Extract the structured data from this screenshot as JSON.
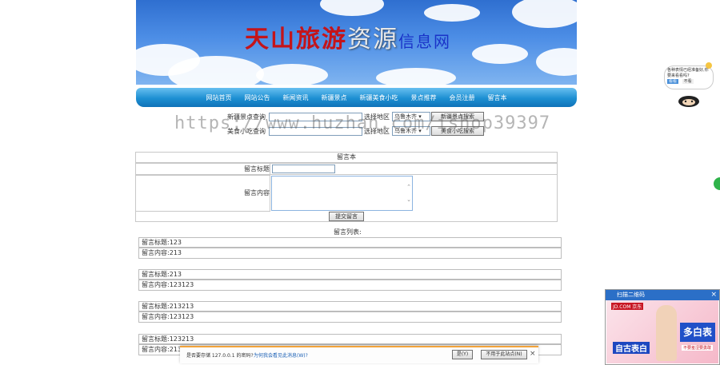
{
  "site_title": {
    "part1": "天山旅游",
    "part2": "资源",
    "part3": "信息网"
  },
  "nav": [
    "网站首页",
    "网站公告",
    "新闻资讯",
    "新疆景点",
    "新疆美食小吃",
    "景点推荐",
    "会员注册",
    "留言本"
  ],
  "search_spots": {
    "label": "新疆景点查询",
    "region_label": "选择地区",
    "region_value": "乌鲁木齐",
    "button": "新疆景点搜索"
  },
  "search_food": {
    "label": "美食小吃查询",
    "region_label": "选择地区",
    "region_value": "乌鲁木齐",
    "button": "美食小吃搜索"
  },
  "watermark": "https://www.huzhan.com/ishop39397",
  "guestbook": {
    "title": "留言本",
    "subject_label": "留言标题",
    "content_label": "留言内容",
    "submit": "提交留言"
  },
  "messages_title": "留言列表:",
  "messages": [
    {
      "title": "留言标题:123",
      "content": "留言内容:213"
    },
    {
      "title": "留言标题:213",
      "content": "留言内容:123123"
    },
    {
      "title": "留言标题:213213",
      "content": "留言内容:123123"
    },
    {
      "title": "留言标题:123213",
      "content": "留言内容:2132"
    }
  ],
  "widget": {
    "text": "各种表情已经准备好,你要来看看吗?",
    "btn_yes": "看看",
    "btn_no": "不看"
  },
  "ad": {
    "header": "扫描二维码",
    "brand": "JD.COM 京东",
    "headline": "多白表",
    "sub1": "自古表白",
    "sub2": "不要羞涩要勇敢"
  },
  "download_bar": {
    "text": "是否要存储 127.0.0.1 的密码?",
    "link": "为何我会看见此消息(W)?",
    "yes": "是(Y)",
    "never": "不用于此站点(N)",
    "close": "×"
  },
  "colors": {
    "nav_blue": "#1d8fd2",
    "title_red": "#c4141a",
    "title_blue": "#1a33c8",
    "dl_accent": "#f2a33a"
  }
}
